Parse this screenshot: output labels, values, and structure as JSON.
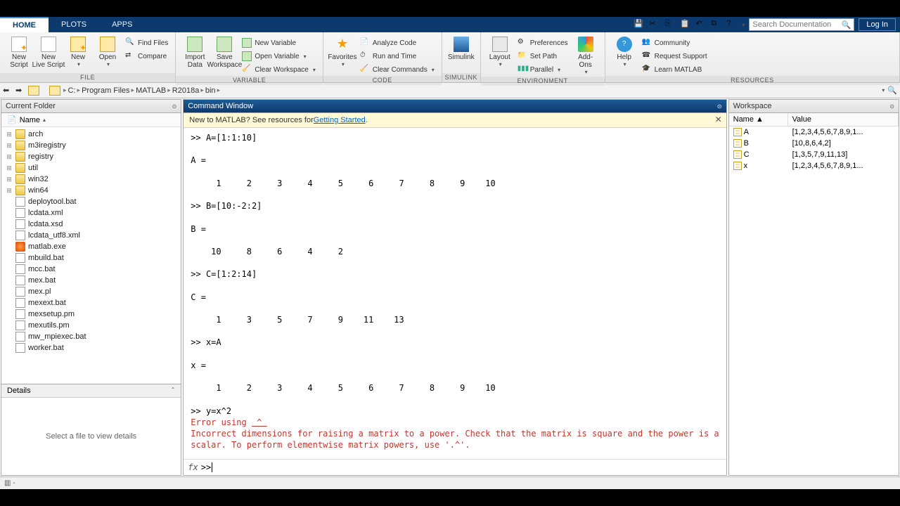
{
  "tabs": {
    "home": "HOME",
    "plots": "PLOTS",
    "apps": "APPS"
  },
  "search_placeholder": "Search Documentation",
  "login": "Log In",
  "toolstrip": {
    "file": {
      "new_script": "New\nScript",
      "new_live": "New\nLive Script",
      "new": "New",
      "open": "Open",
      "find_files": "Find Files",
      "compare": "Compare",
      "label": "FILE"
    },
    "variable": {
      "import": "Import\nData",
      "save_ws": "Save\nWorkspace",
      "new_var": "New Variable",
      "open_var": "Open Variable",
      "clear_ws": "Clear Workspace",
      "label": "VARIABLE"
    },
    "code": {
      "favorites": "Favorites",
      "analyze": "Analyze Code",
      "run_time": "Run and Time",
      "clear_cmd": "Clear Commands",
      "label": "CODE"
    },
    "simulink": {
      "btn": "Simulink",
      "label": "SIMULINK"
    },
    "env": {
      "layout": "Layout",
      "prefs": "Preferences",
      "set_path": "Set Path",
      "parallel": "Parallel",
      "addons": "Add-Ons",
      "label": "ENVIRONMENT"
    },
    "res": {
      "help": "Help",
      "community": "Community",
      "support": "Request Support",
      "learn": "Learn MATLAB",
      "label": "RESOURCES"
    }
  },
  "breadcrumb": [
    "C:",
    "Program Files",
    "MATLAB",
    "R2018a",
    "bin"
  ],
  "panels": {
    "current_folder": "Current Folder",
    "command_window": "Command Window",
    "workspace": "Workspace",
    "details": "Details",
    "details_msg": "Select a file to view details",
    "name_col": "Name"
  },
  "files": [
    {
      "n": "arch",
      "t": "folder",
      "e": true
    },
    {
      "n": "m3iregistry",
      "t": "folder",
      "e": true
    },
    {
      "n": "registry",
      "t": "folder",
      "e": true
    },
    {
      "n": "util",
      "t": "folder",
      "e": true
    },
    {
      "n": "win32",
      "t": "folder",
      "e": true
    },
    {
      "n": "win64",
      "t": "folder",
      "e": true
    },
    {
      "n": "deploytool.bat",
      "t": "bat"
    },
    {
      "n": "lcdata.xml",
      "t": "xml"
    },
    {
      "n": "lcdata.xsd",
      "t": "xml"
    },
    {
      "n": "lcdata_utf8.xml",
      "t": "xml"
    },
    {
      "n": "matlab.exe",
      "t": "exe"
    },
    {
      "n": "mbuild.bat",
      "t": "bat"
    },
    {
      "n": "mcc.bat",
      "t": "bat"
    },
    {
      "n": "mex.bat",
      "t": "bat"
    },
    {
      "n": "mex.pl",
      "t": "bat"
    },
    {
      "n": "mexext.bat",
      "t": "bat"
    },
    {
      "n": "mexsetup.pm",
      "t": "bat"
    },
    {
      "n": "mexutils.pm",
      "t": "bat"
    },
    {
      "n": "mw_mpiexec.bat",
      "t": "bat"
    },
    {
      "n": "worker.bat",
      "t": "bat"
    }
  ],
  "cmd": {
    "banner_prefix": "New to MATLAB? See resources for ",
    "banner_link": "Getting Started",
    "lines": [
      ">> A=[1:1:10]",
      "",
      "A =",
      "",
      "     1     2     3     4     5     6     7     8     9    10",
      "",
      ">> B=[10:-2:2]",
      "",
      "B =",
      "",
      "    10     8     6     4     2",
      "",
      ">> C=[1:2:14]",
      "",
      "C =",
      "",
      "     1     3     5     7     9    11    13",
      "",
      ">> x=A",
      "",
      "x =",
      "",
      "     1     2     3     4     5     6     7     8     9    10",
      "",
      ">> y=x^2"
    ],
    "error1": "Error using  ^ ",
    "error2": "Incorrect dimensions for raising a matrix to a power. Check that the matrix is square and the power is a\nscalar. To perform elementwise matrix powers, use '.^'.",
    "prompt": ">> "
  },
  "ws": {
    "name_hdr": "Name ▲",
    "value_hdr": "Value",
    "vars": [
      {
        "n": "A",
        "v": "[1,2,3,4,5,6,7,8,9,1..."
      },
      {
        "n": "B",
        "v": "[10,8,6,4,2]"
      },
      {
        "n": "C",
        "v": "[1,3,5,7,9,11,13]"
      },
      {
        "n": "x",
        "v": "[1,2,3,4,5,6,7,8,9,1..."
      }
    ]
  }
}
